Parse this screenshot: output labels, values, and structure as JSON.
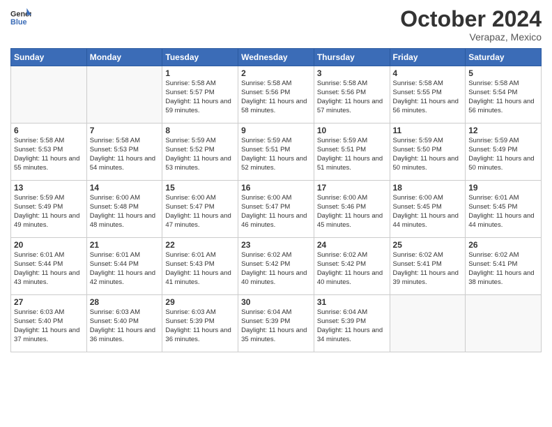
{
  "header": {
    "logo_line1": "General",
    "logo_line2": "Blue",
    "month": "October 2024",
    "location": "Verapaz, Mexico"
  },
  "weekdays": [
    "Sunday",
    "Monday",
    "Tuesday",
    "Wednesday",
    "Thursday",
    "Friday",
    "Saturday"
  ],
  "weeks": [
    [
      {
        "day": "",
        "text": ""
      },
      {
        "day": "",
        "text": ""
      },
      {
        "day": "1",
        "text": "Sunrise: 5:58 AM\nSunset: 5:57 PM\nDaylight: 11 hours and 59 minutes."
      },
      {
        "day": "2",
        "text": "Sunrise: 5:58 AM\nSunset: 5:56 PM\nDaylight: 11 hours and 58 minutes."
      },
      {
        "day": "3",
        "text": "Sunrise: 5:58 AM\nSunset: 5:56 PM\nDaylight: 11 hours and 57 minutes."
      },
      {
        "day": "4",
        "text": "Sunrise: 5:58 AM\nSunset: 5:55 PM\nDaylight: 11 hours and 56 minutes."
      },
      {
        "day": "5",
        "text": "Sunrise: 5:58 AM\nSunset: 5:54 PM\nDaylight: 11 hours and 56 minutes."
      }
    ],
    [
      {
        "day": "6",
        "text": "Sunrise: 5:58 AM\nSunset: 5:53 PM\nDaylight: 11 hours and 55 minutes."
      },
      {
        "day": "7",
        "text": "Sunrise: 5:58 AM\nSunset: 5:53 PM\nDaylight: 11 hours and 54 minutes."
      },
      {
        "day": "8",
        "text": "Sunrise: 5:59 AM\nSunset: 5:52 PM\nDaylight: 11 hours and 53 minutes."
      },
      {
        "day": "9",
        "text": "Sunrise: 5:59 AM\nSunset: 5:51 PM\nDaylight: 11 hours and 52 minutes."
      },
      {
        "day": "10",
        "text": "Sunrise: 5:59 AM\nSunset: 5:51 PM\nDaylight: 11 hours and 51 minutes."
      },
      {
        "day": "11",
        "text": "Sunrise: 5:59 AM\nSunset: 5:50 PM\nDaylight: 11 hours and 50 minutes."
      },
      {
        "day": "12",
        "text": "Sunrise: 5:59 AM\nSunset: 5:49 PM\nDaylight: 11 hours and 50 minutes."
      }
    ],
    [
      {
        "day": "13",
        "text": "Sunrise: 5:59 AM\nSunset: 5:49 PM\nDaylight: 11 hours and 49 minutes."
      },
      {
        "day": "14",
        "text": "Sunrise: 6:00 AM\nSunset: 5:48 PM\nDaylight: 11 hours and 48 minutes."
      },
      {
        "day": "15",
        "text": "Sunrise: 6:00 AM\nSunset: 5:47 PM\nDaylight: 11 hours and 47 minutes."
      },
      {
        "day": "16",
        "text": "Sunrise: 6:00 AM\nSunset: 5:47 PM\nDaylight: 11 hours and 46 minutes."
      },
      {
        "day": "17",
        "text": "Sunrise: 6:00 AM\nSunset: 5:46 PM\nDaylight: 11 hours and 45 minutes."
      },
      {
        "day": "18",
        "text": "Sunrise: 6:00 AM\nSunset: 5:45 PM\nDaylight: 11 hours and 44 minutes."
      },
      {
        "day": "19",
        "text": "Sunrise: 6:01 AM\nSunset: 5:45 PM\nDaylight: 11 hours and 44 minutes."
      }
    ],
    [
      {
        "day": "20",
        "text": "Sunrise: 6:01 AM\nSunset: 5:44 PM\nDaylight: 11 hours and 43 minutes."
      },
      {
        "day": "21",
        "text": "Sunrise: 6:01 AM\nSunset: 5:44 PM\nDaylight: 11 hours and 42 minutes."
      },
      {
        "day": "22",
        "text": "Sunrise: 6:01 AM\nSunset: 5:43 PM\nDaylight: 11 hours and 41 minutes."
      },
      {
        "day": "23",
        "text": "Sunrise: 6:02 AM\nSunset: 5:42 PM\nDaylight: 11 hours and 40 minutes."
      },
      {
        "day": "24",
        "text": "Sunrise: 6:02 AM\nSunset: 5:42 PM\nDaylight: 11 hours and 40 minutes."
      },
      {
        "day": "25",
        "text": "Sunrise: 6:02 AM\nSunset: 5:41 PM\nDaylight: 11 hours and 39 minutes."
      },
      {
        "day": "26",
        "text": "Sunrise: 6:02 AM\nSunset: 5:41 PM\nDaylight: 11 hours and 38 minutes."
      }
    ],
    [
      {
        "day": "27",
        "text": "Sunrise: 6:03 AM\nSunset: 5:40 PM\nDaylight: 11 hours and 37 minutes."
      },
      {
        "day": "28",
        "text": "Sunrise: 6:03 AM\nSunset: 5:40 PM\nDaylight: 11 hours and 36 minutes."
      },
      {
        "day": "29",
        "text": "Sunrise: 6:03 AM\nSunset: 5:39 PM\nDaylight: 11 hours and 36 minutes."
      },
      {
        "day": "30",
        "text": "Sunrise: 6:04 AM\nSunset: 5:39 PM\nDaylight: 11 hours and 35 minutes."
      },
      {
        "day": "31",
        "text": "Sunrise: 6:04 AM\nSunset: 5:39 PM\nDaylight: 11 hours and 34 minutes."
      },
      {
        "day": "",
        "text": ""
      },
      {
        "day": "",
        "text": ""
      }
    ]
  ]
}
